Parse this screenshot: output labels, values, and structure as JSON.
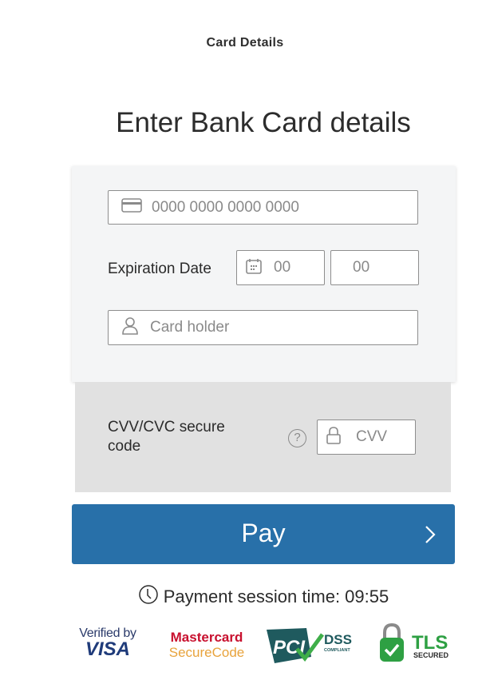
{
  "header": {
    "title": "Card Details"
  },
  "main": {
    "title": "Enter Bank Card details"
  },
  "form": {
    "card_number": {
      "placeholder": "0000 0000 0000 0000",
      "icon": "credit-card-icon"
    },
    "expiration": {
      "label": "Expiration Date",
      "month_placeholder": "00",
      "year_placeholder": "00",
      "icon": "calendar-icon"
    },
    "card_holder": {
      "placeholder": "Card holder",
      "icon": "user-icon"
    },
    "cvv": {
      "label": "CVV/CVC secure code",
      "placeholder": "CVV",
      "help_icon": "question-circle-icon",
      "help_symbol": "?",
      "icon": "lock-icon"
    }
  },
  "pay_button": {
    "label": "Pay",
    "icon": "chevron-right-icon"
  },
  "session": {
    "label": "Payment session time: 09:55",
    "icon": "clock-icon"
  },
  "badges": {
    "visa": {
      "line1": "Verified by",
      "line2": "VISA"
    },
    "mastercard": {
      "line1": "Mastercard",
      "line2": "SecureCode"
    },
    "pci": {
      "logo": "PCI",
      "line1": "DSS",
      "line2": "COMPLIANT"
    },
    "tls": {
      "line1": "TLS",
      "line2": "SECURED"
    }
  },
  "colors": {
    "accent": "#2870a9",
    "panel": "#f4f5f6",
    "cvv_panel": "#e1e1e1",
    "pci_teal": "#1f5a5e",
    "secure_green": "#2ea043"
  }
}
